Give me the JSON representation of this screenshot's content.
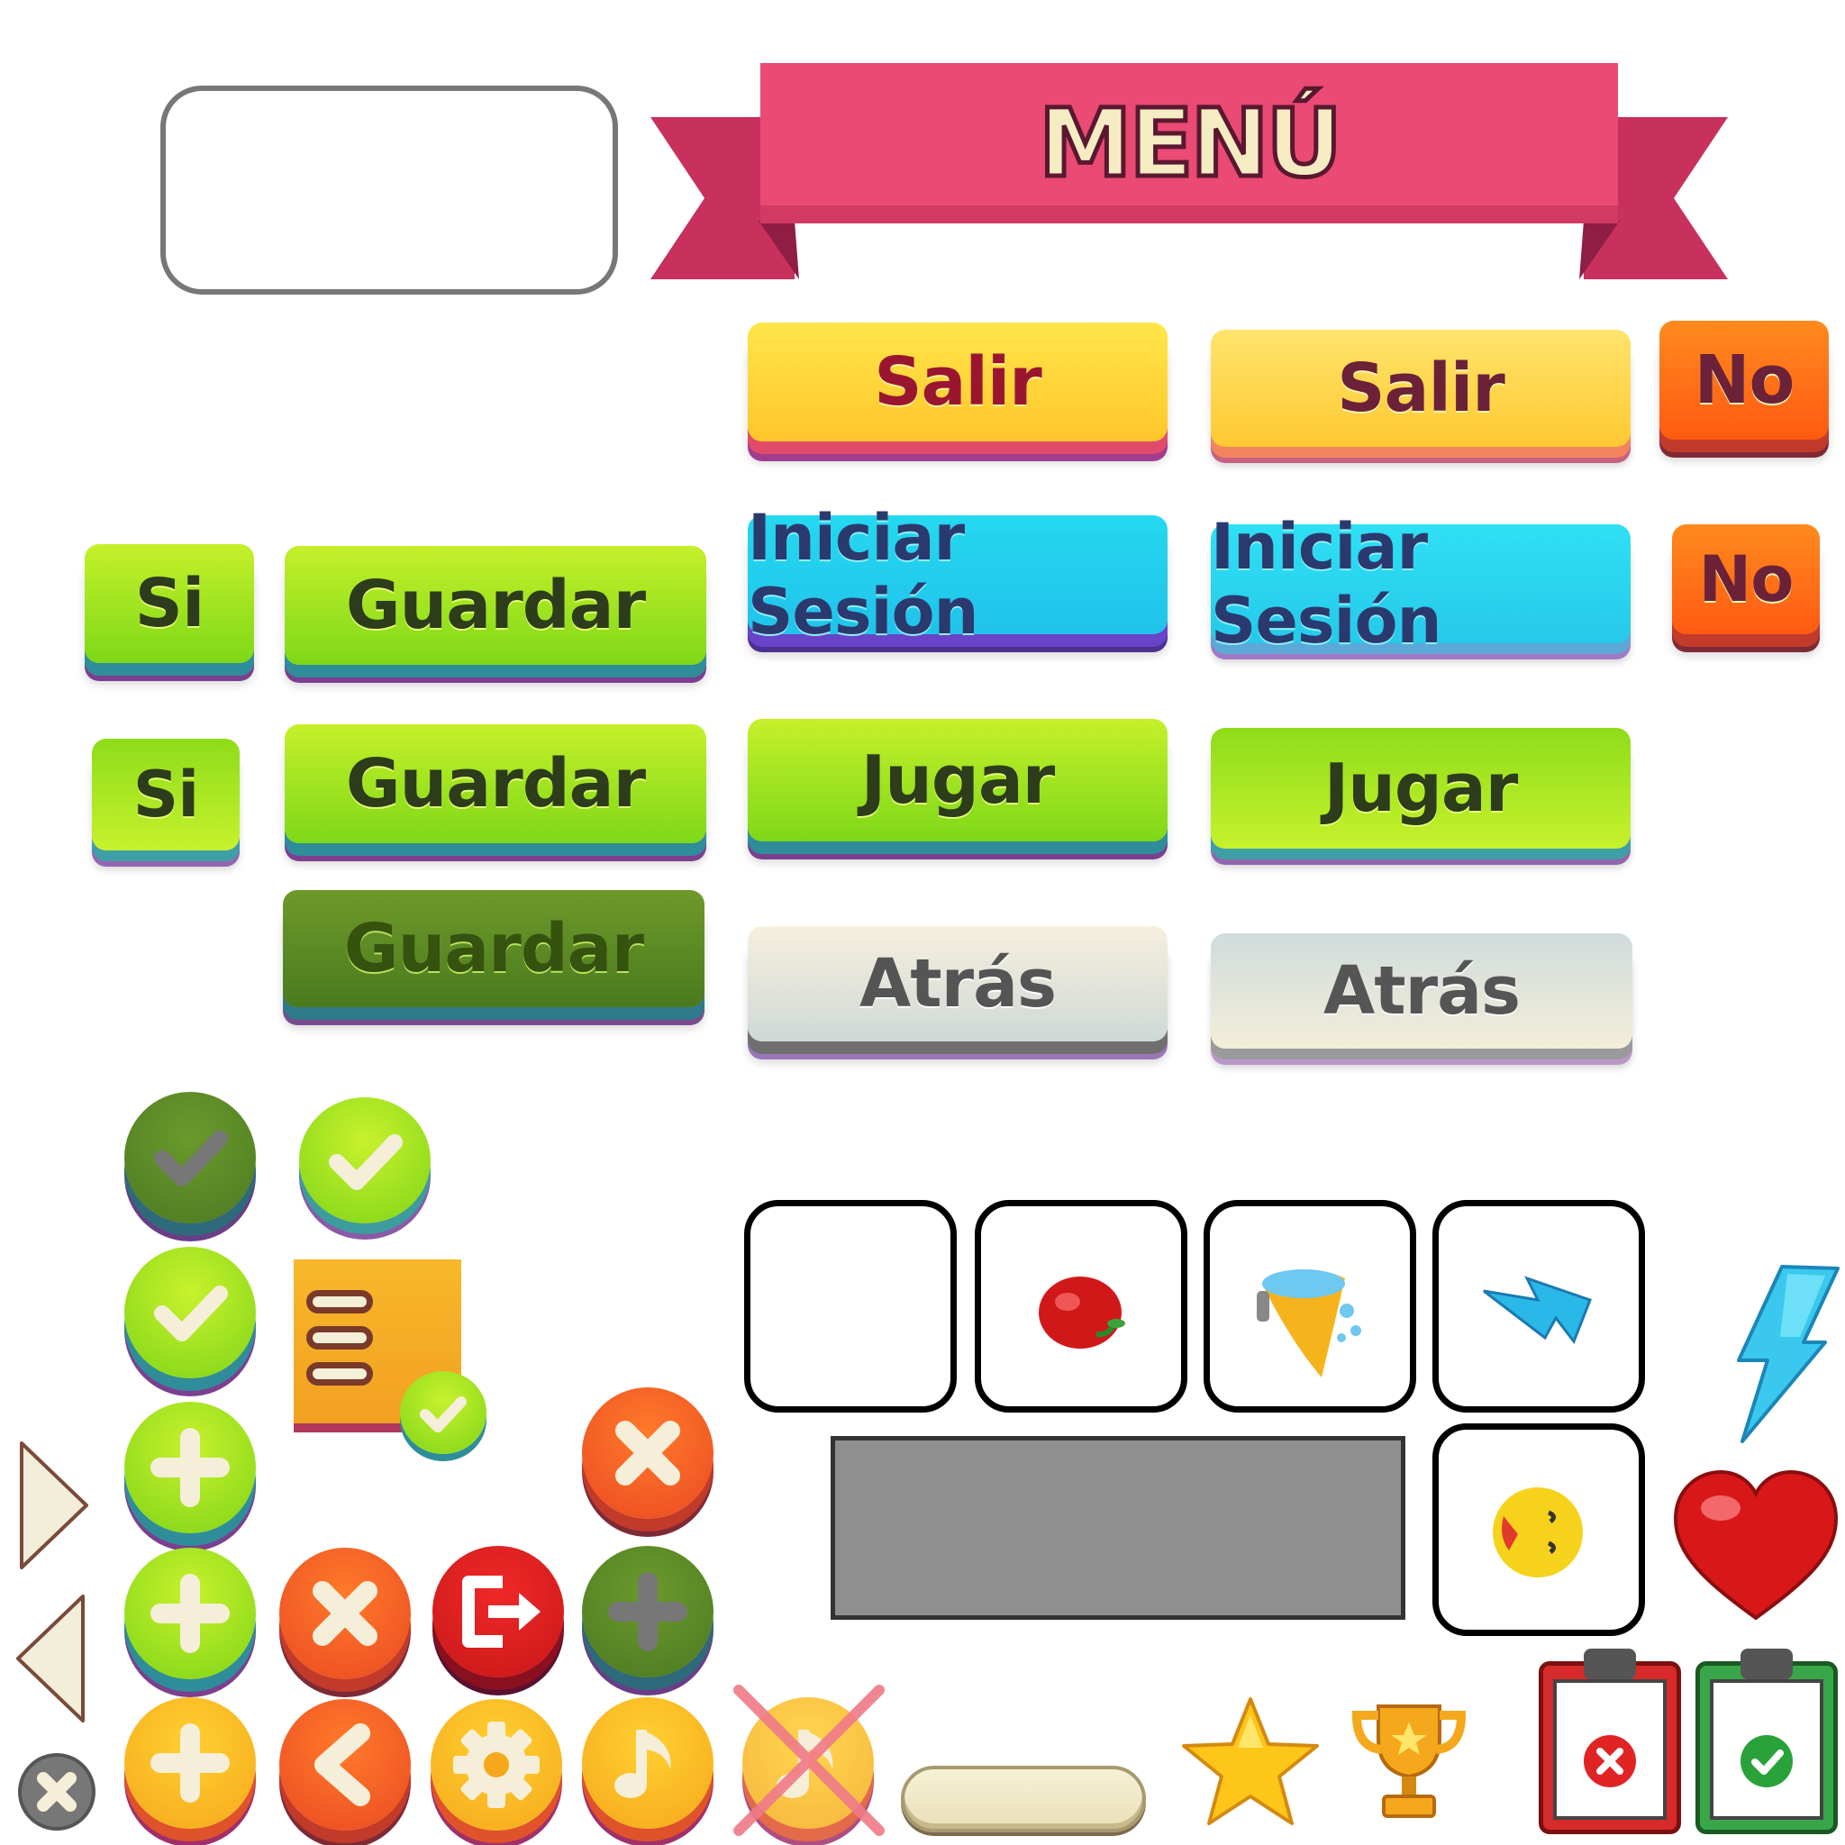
{
  "banner": {
    "title": "MENÚ"
  },
  "buttons": {
    "salir_pressed": "Salir",
    "salir_normal": "Salir",
    "no_large": "No",
    "no_small": "No",
    "login_pressed": "Iniciar Sesión",
    "login_normal": "Iniciar Sesión",
    "si_large": "Si",
    "si_small": "Si",
    "guardar_normal": "Guardar",
    "guardar_hover": "Guardar",
    "guardar_disabled": "Guardar",
    "jugar_pressed": "Jugar",
    "jugar_normal": "Jugar",
    "atras_pressed": "Atrás",
    "atras_normal": "Atrás"
  },
  "icons": {
    "check_disabled": "check-icon",
    "check_normal": "check-icon",
    "check_pressed": "check-icon",
    "task_list": "list-check-icon",
    "plus": "plus-icon",
    "close": "close-icon",
    "exit": "exit-icon",
    "back": "chevron-left-icon",
    "settings": "gear-icon",
    "music": "music-note-icon",
    "music_off": "music-off-icon",
    "apple": "apple-icon",
    "bath": "bathtub-icon",
    "energy": "lightning-icon",
    "smile": "smiley-icon",
    "heart": "heart-icon",
    "star": "star-icon",
    "trophy": "trophy-icon",
    "clipboard_fail": "clipboard-x-icon",
    "clipboard_ok": "clipboard-check-icon",
    "arrow_right": "triangle-right-icon",
    "arrow_left": "triangle-left-icon"
  },
  "colors": {
    "banner_pink": "#ea4a73",
    "banner_dark": "#b22a56",
    "yellow": "#ffd83a",
    "orange": "#ff6a18",
    "cyan": "#24d0ee",
    "green": "#a6e620",
    "olive": "#5a8a24",
    "cream": "#f3eed9",
    "red": "#e03a2a",
    "panel_grey": "#8f8f8f"
  }
}
